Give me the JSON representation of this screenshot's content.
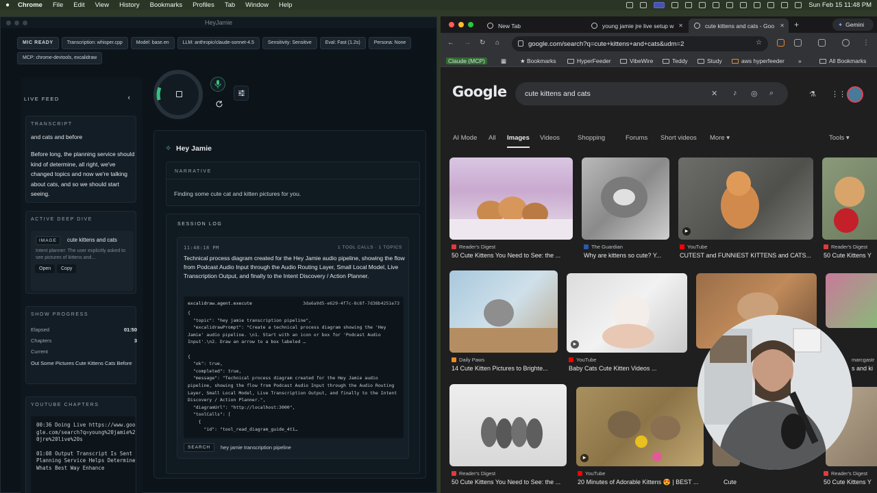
{
  "menubar": {
    "app": "Chrome",
    "items": [
      "File",
      "Edit",
      "View",
      "History",
      "Bookmarks",
      "Profiles",
      "Tab",
      "Window",
      "Help"
    ],
    "clock": "Sun Feb 15  11:48 PM"
  },
  "hj": {
    "window_title": "HeyJamie",
    "pills": [
      "MIC READY",
      "Transcription: whisper.cpp",
      "Model: base.en",
      "LLM: anthropic/claude-sonnet-4.5",
      "Sensitivity: Sensitive",
      "Eval: Fast (1.2s)",
      "Persona: None",
      "MCP: chrome-devtools, excalidraw"
    ],
    "live_feed": {
      "label": "LIVE FEED",
      "transcript_label": "TRANSCRIPT",
      "transcript_line1": "and cats and before",
      "transcript_body": "Before long, the planning service should kind of determine, all right, we've changed topics and now we're talking about cats, and so we should start seeing.",
      "deep_dive_label": "ACTIVE DEEP DIVE",
      "deep_dive_tag": "IMAGE",
      "deep_dive_topic": "cute kittens and cats",
      "deep_dive_desc": "Intent planner: The user explicitly asked to see pictures of kittens and...",
      "open_label": "Open",
      "copy_label": "Copy",
      "progress_label": "SHOW PROGRESS",
      "elapsed_label": "Elapsed",
      "elapsed_value": "01:50",
      "chapters_label": "Chapters",
      "chapters_value": "3",
      "current_label": "Current",
      "current_value": "Out Some Pictures Cute Kittens Cats Before",
      "yt_label": "YOUTUBE CHAPTERS",
      "yt_chapters": [
        "00:36 Doing Live https://www.google.com/search?q=young%20jamie%20jre%20live%20s",
        "01:08 Output Transcript Is Sent Planning Service Helps Determine Whats Best Way Enhance"
      ]
    },
    "main": {
      "title": "Hey Jamie",
      "narrative_label": "NARRATIVE",
      "narrative_text": "Finding some cute cat and kitten pictures for you.",
      "session_label": "SESSION LOG",
      "entry_time": "11:48:18 PM",
      "entry_meta": "1 TOOL CALLS · 1 TOPICS",
      "entry_summary": "Technical process diagram created for the Hey Jamie audio pipeline, showing the flow from Podcast Audio Input through the Audio Routing Layer, Small Local Model, Live Transcription Output, and finally to the Intent Discovery / Action Planner.",
      "tool_name": "excalidraw.agent.execute",
      "tool_id": "3da6a9d5-e629-4f7c-8c8f-7d38b4251e73",
      "code": "{\n  \"topic\": \"hey jamie transcription pipeline\",\n  \"excalidrawPrompt\": \"Create a technical process diagram showing the 'Hey Jamie' audio pipeline. \\n1. Start with an icon or box for 'Podcast Audio Input'.\\n2. Draw an arrow to a box labeled …\n\n{\n  \"ok\": true,\n  \"completed\": true,\n  \"message\": \"Technical process diagram created for the Hey Jamie audio pipeline, showing the flow from Podcast Audio Input through the Audio Routing Layer, Small Local Model, Live Transcription Output, and finally to the Intent Discovery / Action Planner.\",\n  \"diagramUrl\": \"http://localhost:3000\",\n  \"toolCalls\": [\n    {\n      \"id\": \"tool_read_diagram_guide_4t1…",
      "search_tag": "SEARCH",
      "search_query": "hey jamie transcription pipeline"
    }
  },
  "chrome": {
    "tabs": [
      {
        "title": "New Tab"
      },
      {
        "title": "young jamie jre live setup w"
      },
      {
        "title": "cute kittens and cats - Goo"
      }
    ],
    "gemini_label": "Gemini",
    "url": "google.com/search?q=cute+kittens+and+cats&udm=2",
    "bookmarks": [
      "Claude (MCP)",
      "Bookmarks",
      "HyperFeeder",
      "VibeWire",
      "Teddy",
      "Study",
      "aws hyperfeeder",
      "All Bookmarks"
    ],
    "google": {
      "logo": "Google",
      "query": "cute kittens and cats",
      "tabs": [
        "AI Mode",
        "All",
        "Images",
        "Videos",
        "Shopping",
        "Forums",
        "Short videos",
        "More ▾"
      ],
      "active_tab": "Images",
      "tools_label": "Tools ▾",
      "results": [
        {
          "source": "Reader's Digest",
          "caption": "50 Cute Kittens You Need to See: the ...",
          "src_color": "#e23a3a"
        },
        {
          "source": "The Guardian",
          "caption": "Why are kittens so cute? Y...",
          "src_color": "#2b5aa8"
        },
        {
          "source": "YouTube",
          "caption": "CUTEST and FUNNIEST KITTENS and CATS...",
          "src_color": "#ff0000"
        },
        {
          "source": "Reader's Digest",
          "caption": "50 Cute Kittens Y",
          "src_color": "#e23a3a"
        },
        {
          "source": "Daily Paws",
          "caption": "14 Cute Kitten Pictures to Brighte...",
          "src_color": "#f08a24"
        },
        {
          "source": "YouTube",
          "caption": "Baby Cats Cute Kitten Videos ...",
          "src_color": "#ff0000"
        },
        {
          "source": "marcgastr",
          "caption": "s and ki",
          "src_color": "#777777"
        },
        {
          "source": "Reader's Digest",
          "caption": "50 Cute Kittens You Need to See: the ...",
          "src_color": "#e23a3a"
        },
        {
          "source": "YouTube",
          "caption": "20 Minutes of Adorable Kittens 😍 | BEST ...",
          "src_color": "#ff0000"
        },
        {
          "source": "Cute",
          "caption": "Cute",
          "src_color": "#777777"
        },
        {
          "source": "Reader's Digest",
          "caption": "50 Cute Kittens Y",
          "src_color": "#e23a3a"
        }
      ]
    }
  }
}
